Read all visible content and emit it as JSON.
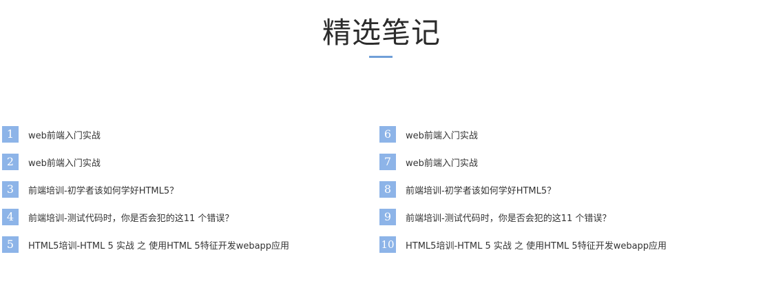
{
  "header": {
    "title": "精选笔记"
  },
  "colors": {
    "accent": "#6f9fd8",
    "badge": "#8db4e8",
    "text": "#333333"
  },
  "notes": {
    "left": [
      {
        "num": "1",
        "title": "web前端入门实战"
      },
      {
        "num": "2",
        "title": "web前端入门实战"
      },
      {
        "num": "3",
        "title": "前端培训-初学者该如何学好HTML5？"
      },
      {
        "num": "4",
        "title": "前端培训-测试代码时，你是否会犯的这11 个错误？"
      },
      {
        "num": "5",
        "title": "HTML5培训-HTML 5 实战 之 使用HTML 5特征开发webapp应用"
      }
    ],
    "right": [
      {
        "num": "6",
        "title": "web前端入门实战"
      },
      {
        "num": "7",
        "title": "web前端入门实战"
      },
      {
        "num": "8",
        "title": "前端培训-初学者该如何学好HTML5？"
      },
      {
        "num": "9",
        "title": "前端培训-测试代码时，你是否会犯的这11 个错误？"
      },
      {
        "num": "10",
        "title": "HTML5培训-HTML 5 实战 之 使用HTML 5特征开发webapp应用"
      }
    ]
  }
}
